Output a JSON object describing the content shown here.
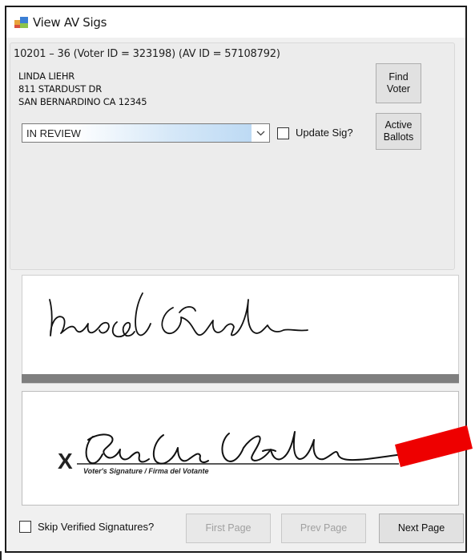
{
  "window": {
    "title": "View AV Sigs",
    "icon": "form-app-icon"
  },
  "voter": {
    "header": "10201 – 36 (Voter ID = 323198) (AV ID = 57108792)",
    "name": "LINDA LIEHR",
    "street": "811 STARDUST DR",
    "city_line": "SAN BERNARDINO CA 12345"
  },
  "buttons": {
    "find_voter": "Find\nVoter",
    "active_ballots": "Active\nBallots",
    "first_page": "First Page",
    "prev_page": "Prev Page",
    "next_page": "Next Page"
  },
  "status": {
    "selected": "IN REVIEW"
  },
  "options": {
    "update_sig_label": "Update Sig?",
    "update_sig_checked": false,
    "skip_verified_label": "Skip Verified Signatures?",
    "skip_verified_checked": false
  },
  "signature_form": {
    "mark": "X",
    "caption": "Voter's Signature / Firma del Votante"
  },
  "colors": {
    "annotation_arrow": "#ee0000",
    "selection_gradient": "#b8d7f3",
    "separator_bar": "#7f7f7f"
  }
}
